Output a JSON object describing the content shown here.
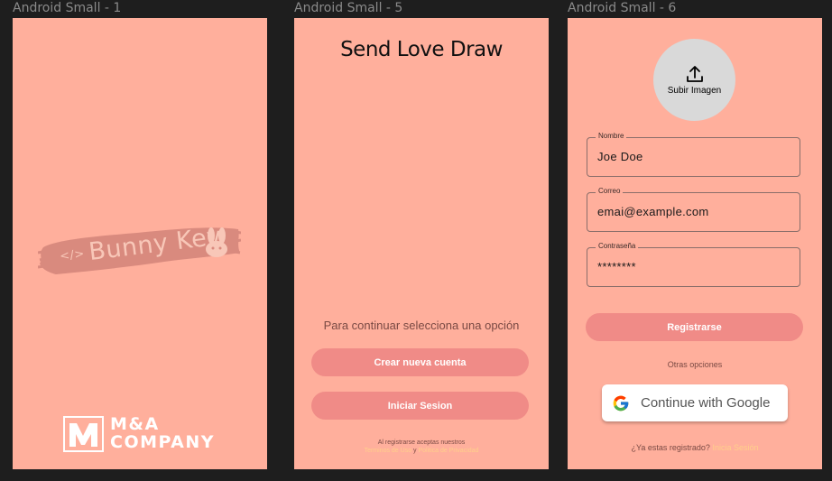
{
  "frames": [
    {
      "label": "Android Small - 1"
    },
    {
      "label": "Android Small - 5"
    },
    {
      "label": "Android Small - 6"
    }
  ],
  "splash": {
    "app_code_symbol": "</>",
    "app_name": "Bunny Key",
    "company_line1": "M&A",
    "company_line2": "COMPANY"
  },
  "welcome": {
    "title": "Send Love Draw",
    "prompt": "Para continuar selecciona una opción",
    "create_account_label": "Crear nueva cuenta",
    "login_label": "Iniciar Sesion",
    "terms_line1": "Al registrarse aceptas nuestros",
    "terms_link": "Terminos de Uso",
    "terms_and": "y",
    "privacy_link": "Politica de Privacidad"
  },
  "register": {
    "upload_label": "Subir Imagen",
    "name_label": "Nombre",
    "name_value": "Joe Doe",
    "email_label": "Correo",
    "email_value": "emai@example.com",
    "password_label": "Contraseña",
    "password_value": "********",
    "register_label": "Registrarse",
    "other_options": "Otras opciones",
    "google_label": "Continue with Google",
    "already_registered": "¿Ya estas registrado?",
    "login_link": "Inicia Sesión"
  },
  "colors": {
    "frame_bg": "#ffaf9c",
    "button": "#f08b87",
    "link": "#ffd08a",
    "canvas": "#1e1e1e"
  }
}
